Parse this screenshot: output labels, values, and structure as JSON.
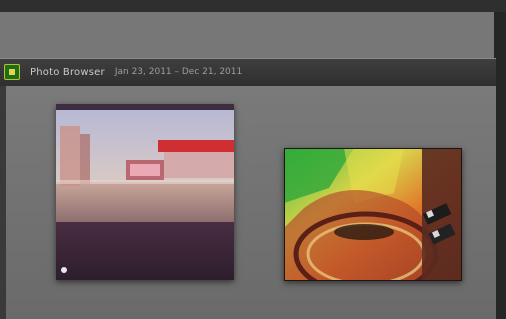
{
  "window": {
    "title": "Photo Browser",
    "subtitle": "Jan 23, 2011 – Dec 21, 2011",
    "app_icon": "photo-app-icon"
  },
  "photos": [
    {
      "name": "street-photo"
    },
    {
      "name": "painting-photo"
    }
  ],
  "colors": {
    "title_bar": "#353535",
    "panel_bg": "#707070",
    "frame_dark": "#262626",
    "app_icon_green": "#1b6f1b"
  }
}
